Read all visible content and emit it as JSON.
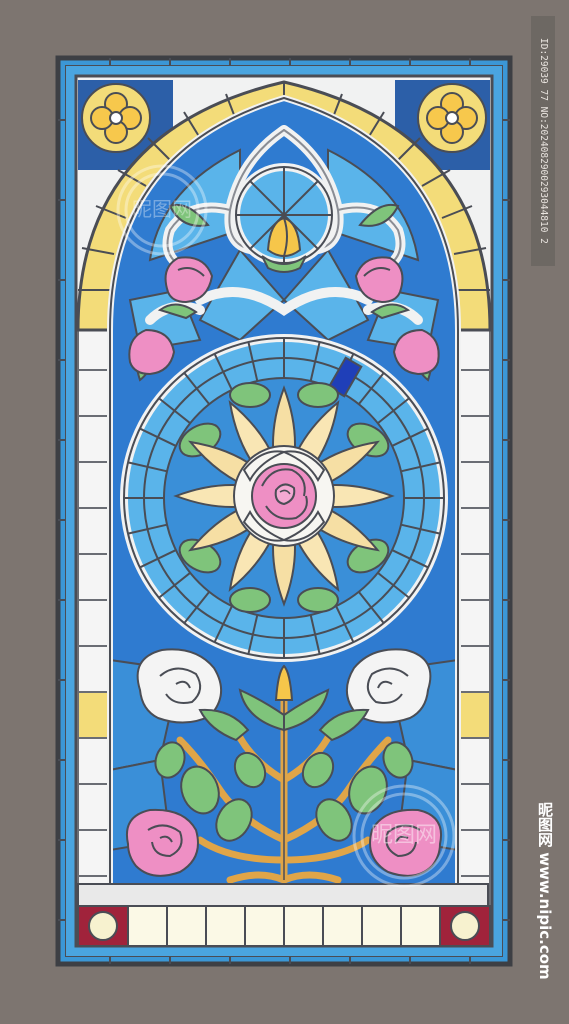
{
  "watermark": {
    "id_text": "ID:29039 77 NO:2024082900293044810 2",
    "site_text": "昵图网 www.nipic.com",
    "stamp_text": "昵图网"
  },
  "colors": {
    "background": "#7d7570",
    "lead_line": "#4a4d55",
    "frame_blue": "#3b97d6",
    "sky_blue": "#5ab4ea",
    "deep_blue": "#2c6fc1",
    "petal_yellow": "#f6dfa4",
    "arch_yellow": "#f3dc79",
    "rose_pink": "#ee8fc4",
    "leaf_green": "#7fc47b",
    "stem_orange": "#e0a548",
    "glass_white": "#f1f2f2",
    "bottom_red": "#a0233b"
  },
  "icons": [
    "rose-icon",
    "sunflower-icon",
    "leaf-icon",
    "bud-icon"
  ]
}
